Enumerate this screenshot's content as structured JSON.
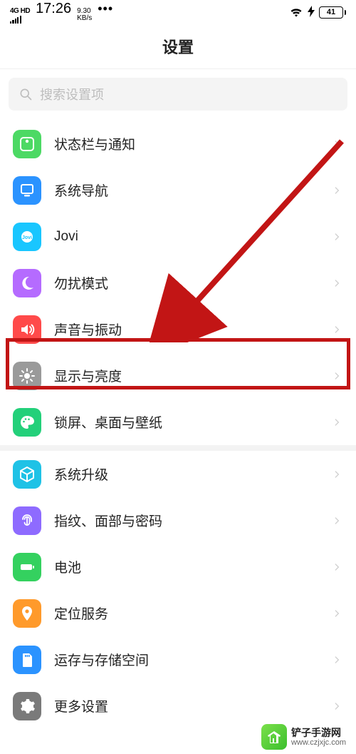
{
  "status": {
    "net_label": "4G HD",
    "time": "17:26",
    "kbs_top": "9.30",
    "kbs_bot": "KB/s",
    "battery_pct": "41"
  },
  "title": "设置",
  "search": {
    "placeholder": "搜索设置项"
  },
  "groups": [
    {
      "items": [
        {
          "key": "status-notif",
          "label": "状态栏与通知",
          "icon": "status-bar-icon",
          "color": "#4cd964"
        },
        {
          "key": "nav",
          "label": "系统导航",
          "icon": "nav-icon",
          "color": "#2b93ff"
        },
        {
          "key": "jovi",
          "label": "Jovi",
          "icon": "jovi-icon",
          "color": "#19c6ff"
        },
        {
          "key": "dnd",
          "label": "勿扰模式",
          "icon": "moon-icon",
          "color": "#b56bff"
        },
        {
          "key": "sound",
          "label": "声音与振动",
          "icon": "sound-icon",
          "color": "#ff4a4a"
        },
        {
          "key": "display",
          "label": "显示与亮度",
          "icon": "brightness-icon",
          "color": "#9a9a9a",
          "highlighted": true
        },
        {
          "key": "wallpaper",
          "label": "锁屏、桌面与壁纸",
          "icon": "palette-icon",
          "color": "#23d07a"
        }
      ]
    },
    {
      "items": [
        {
          "key": "update",
          "label": "系统升级",
          "icon": "cube-icon",
          "color": "#1fc2e6"
        },
        {
          "key": "biometric",
          "label": "指纹、面部与密码",
          "icon": "fingerprint-icon",
          "color": "#8e6bff"
        },
        {
          "key": "battery",
          "label": "电池",
          "icon": "battery-icon",
          "color": "#34d15f"
        },
        {
          "key": "location",
          "label": "定位服务",
          "icon": "location-icon",
          "color": "#ff9a2b"
        },
        {
          "key": "storage",
          "label": "运存与存储空间",
          "icon": "sdcard-icon",
          "color": "#2b93ff"
        },
        {
          "key": "more",
          "label": "更多设置",
          "icon": "gear-icon",
          "color": "#7a7a7a"
        }
      ]
    }
  ],
  "watermark": {
    "line1": "铲子手游网",
    "line2": "www.czjxjc.com"
  }
}
